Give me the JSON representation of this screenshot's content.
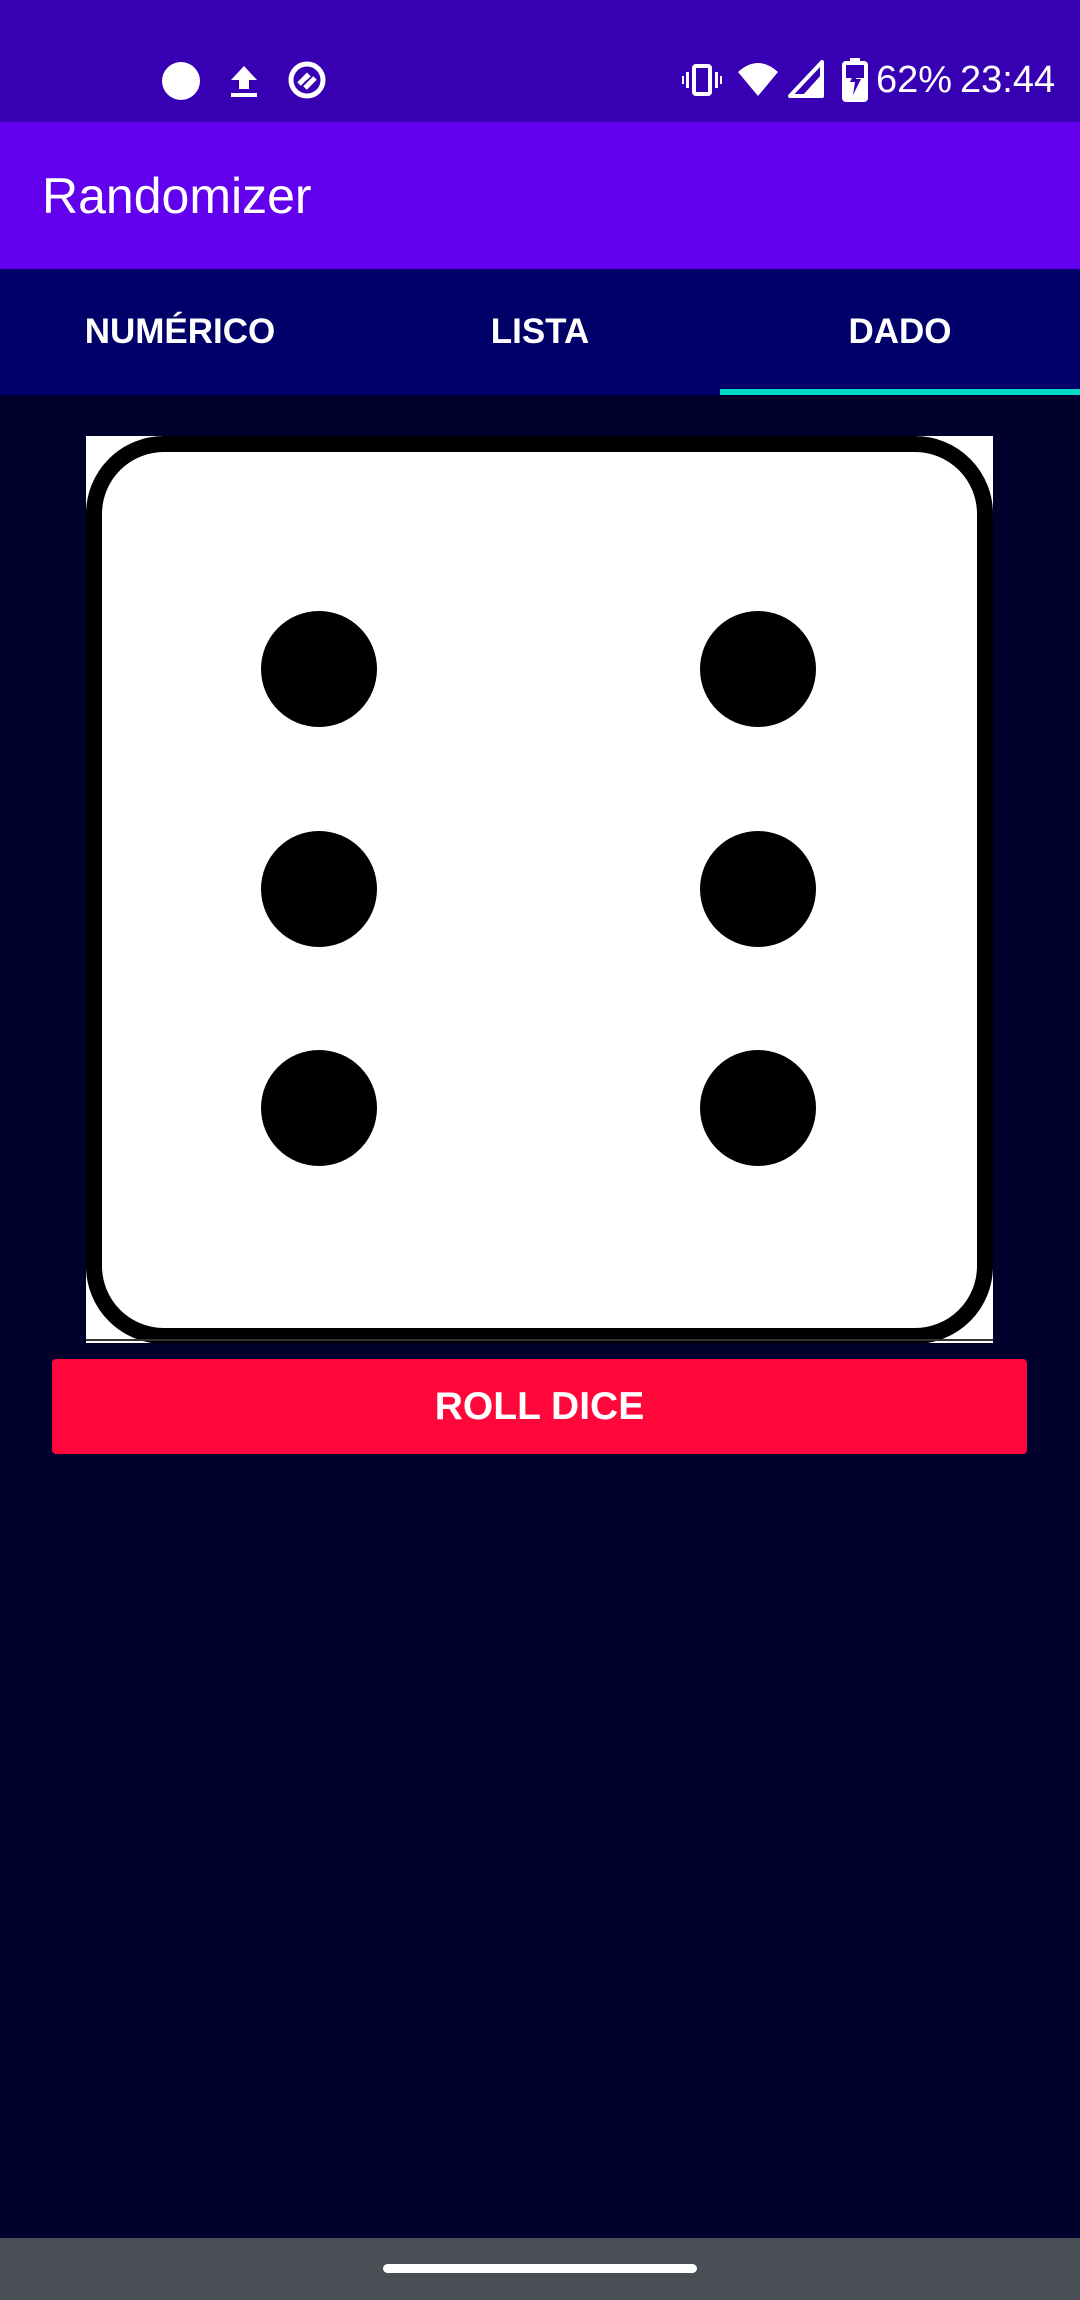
{
  "status_bar": {
    "battery_percent": "62%",
    "time": "23:44",
    "icons": [
      "circle-notification-icon",
      "upload-icon",
      "sync-icon",
      "vibrate-icon",
      "wifi-icon",
      "signal-icon",
      "battery-charging-icon"
    ]
  },
  "app_bar": {
    "title": "Randomizer"
  },
  "tabs": [
    {
      "label": "NUMÉRICO",
      "selected": false
    },
    {
      "label": "LISTA",
      "selected": false
    },
    {
      "label": "DADO",
      "selected": true
    }
  ],
  "dice": {
    "value": 6
  },
  "roll_button": {
    "label": "ROLL DICE"
  },
  "colors": {
    "status_bar": "#3700b3",
    "app_bar": "#6200ee",
    "tab_bar": "#000068",
    "tab_indicator": "#03dac5",
    "background": "#00002c",
    "roll_button": "#ff073a",
    "nav_bar": "#4a4e55"
  }
}
